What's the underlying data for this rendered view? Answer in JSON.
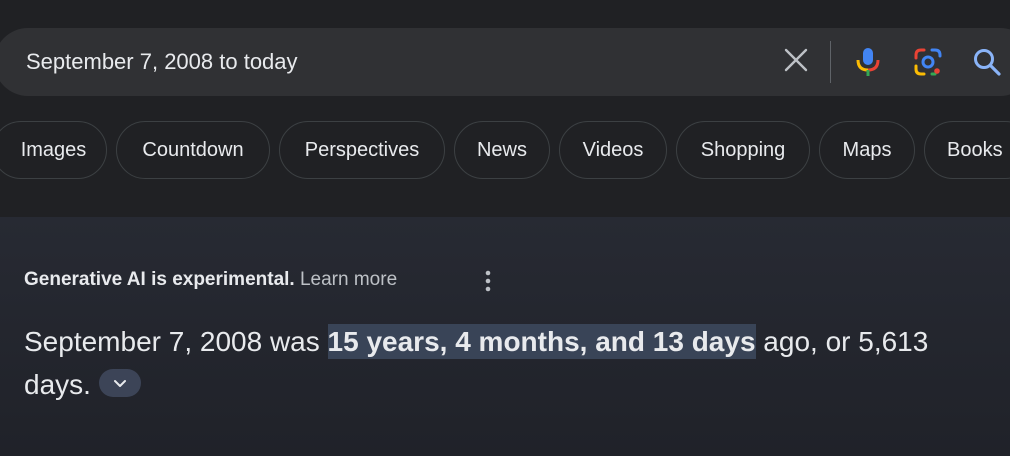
{
  "search": {
    "query": "September 7, 2008 to today"
  },
  "chips": [
    {
      "label": "Images"
    },
    {
      "label": "Countdown"
    },
    {
      "label": "Perspectives"
    },
    {
      "label": "News"
    },
    {
      "label": "Videos"
    },
    {
      "label": "Shopping"
    },
    {
      "label": "Maps"
    },
    {
      "label": "Books"
    }
  ],
  "ai_overview": {
    "notice": "Generative AI is experimental.",
    "learn_more": "Learn more",
    "answer_prefix": "September 7, 2008 was",
    "answer_highlight": "15 years, 4 months, and 13 days",
    "answer_suffix": "ago, or 5,613 days."
  },
  "icons": {
    "clear": "close-icon",
    "mic": "microphone-icon",
    "lens": "google-lens-icon",
    "search": "search-icon",
    "more": "more-vert-icon",
    "expand": "chevron-down-icon"
  },
  "colors": {
    "background": "#202124",
    "search_bar": "#303134",
    "panel": "#272a33",
    "highlight": "#394457",
    "accent_blue": "#8ab4f8"
  }
}
